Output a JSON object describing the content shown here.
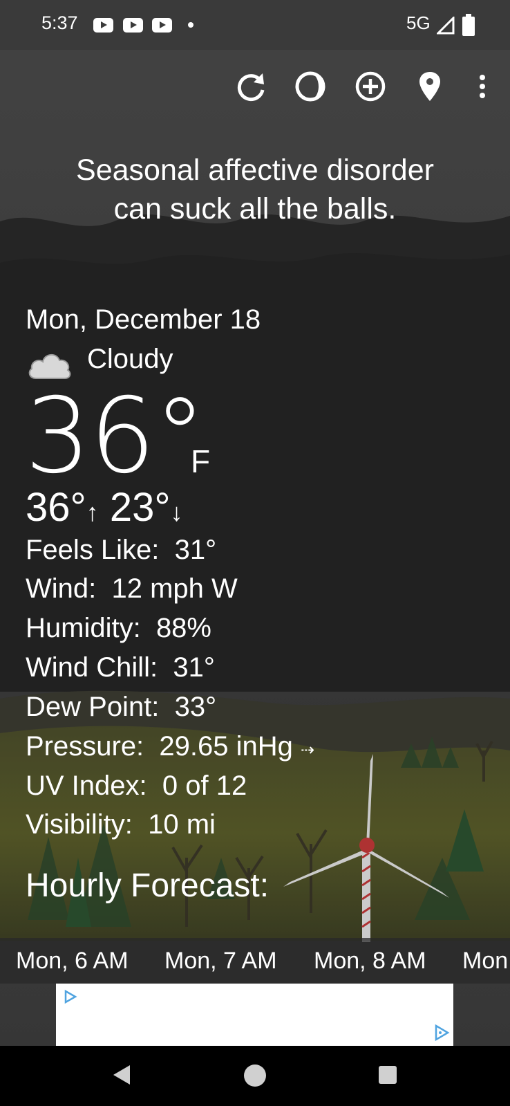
{
  "status_bar": {
    "time": "5:37",
    "network": "5G",
    "icons": [
      "youtube-notification-icon",
      "youtube-notification-icon",
      "youtube-notification-icon",
      "notification-dot",
      "signal-icon",
      "battery-icon"
    ]
  },
  "toolbar": {
    "icons": [
      "refresh-icon",
      "theme-icon",
      "add-location-icon",
      "location-pin-icon",
      "more-options-icon"
    ]
  },
  "tagline": {
    "line1": "Seasonal affective disorder",
    "line2": "can suck all the balls."
  },
  "current": {
    "date": "Mon, December 18",
    "condition": "Cloudy",
    "condition_icon": "cloud-icon",
    "temperature": "36°",
    "unit": "F",
    "high": "36°",
    "low": "23°"
  },
  "details": [
    {
      "label": "Feels Like:",
      "value": "31°"
    },
    {
      "label": "Wind:",
      "value": "12 mph W"
    },
    {
      "label": "Humidity:",
      "value": "88%"
    },
    {
      "label": "Wind Chill:",
      "value": "31°"
    },
    {
      "label": "Dew Point:",
      "value": "33°"
    },
    {
      "label": "Pressure:",
      "value": "29.65 inHg"
    },
    {
      "label": "UV Index:",
      "value": "0 of 12"
    },
    {
      "label": "Visibility:",
      "value": "10 mi"
    }
  ],
  "hourly": {
    "title": "Hourly Forecast:",
    "hours": [
      "Mon, 6 AM",
      "Mon, 7 AM",
      "Mon, 8 AM",
      "Mon"
    ]
  },
  "colors": {
    "sky": "#4a4a4a",
    "status_bar": "#3a3a3a",
    "ground": "#6c6f31"
  }
}
